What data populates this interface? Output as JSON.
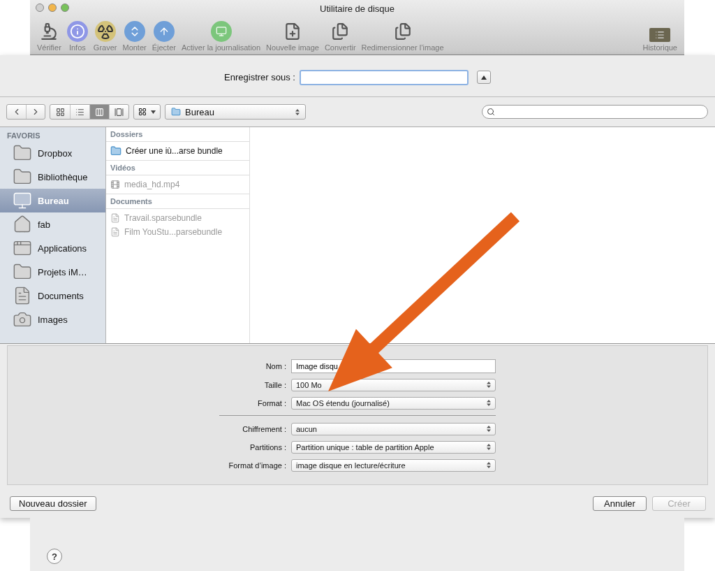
{
  "window": {
    "title": "Utilitaire de disque"
  },
  "toolbar": [
    {
      "label": "Vérifier"
    },
    {
      "label": "Infos"
    },
    {
      "label": "Graver"
    },
    {
      "label": "Monter"
    },
    {
      "label": "Éjecter"
    },
    {
      "label": "Activer la journalisation"
    },
    {
      "label": "Nouvelle image"
    },
    {
      "label": "Convertir"
    },
    {
      "label": "Redimensionner l’image"
    },
    {
      "label": "Historique"
    }
  ],
  "save_as": {
    "label": "Enregistrer sous :"
  },
  "view_modes": [
    {
      "selected": false
    },
    {
      "selected": false
    },
    {
      "selected": true
    },
    {
      "selected": false
    }
  ],
  "location": "Bureau",
  "sidebar": {
    "heading": "FAVORIS",
    "items": [
      {
        "label": "Dropbox",
        "selected": false
      },
      {
        "label": "Bibliothèque",
        "selected": false
      },
      {
        "label": "Bureau",
        "selected": true
      },
      {
        "label": "fab",
        "selected": false
      },
      {
        "label": "Applications",
        "selected": false
      },
      {
        "label": "Projets iM…",
        "selected": false
      },
      {
        "label": "Documents",
        "selected": false
      },
      {
        "label": "Images",
        "selected": false
      }
    ]
  },
  "column": [
    {
      "heading": "Dossiers",
      "items": [
        {
          "name": "Créer une iù...arse bundle",
          "kind": "folder",
          "disabled": false
        }
      ]
    },
    {
      "heading": "Vidéos",
      "items": [
        {
          "name": "media_hd.mp4",
          "kind": "video",
          "disabled": true
        }
      ]
    },
    {
      "heading": "Documents",
      "items": [
        {
          "name": "Travail.sparsebundle",
          "kind": "document",
          "disabled": true
        },
        {
          "name": "Film YouStu...parsebundle",
          "kind": "document",
          "disabled": true
        }
      ]
    }
  ],
  "options": [
    [
      {
        "label": "Nom :",
        "kind": "field",
        "value": "Image disqu"
      },
      {
        "label": "Taille :",
        "kind": "popup",
        "value": "100 Mo"
      },
      {
        "label": "Format :",
        "kind": "popup",
        "value": "Mac OS étendu (journalisé)"
      }
    ],
    [
      {
        "label": "Chiffrement :",
        "kind": "popup",
        "value": "aucun"
      },
      {
        "label": "Partitions :",
        "kind": "popup",
        "value": "Partition unique : table de partition Apple"
      },
      {
        "label": "Format d’image :",
        "kind": "popup",
        "value": "image disque en lecture/écriture"
      }
    ]
  ],
  "buttons": {
    "left": {
      "label": "Nouveau dossier",
      "disabled": false
    },
    "right": [
      {
        "label": "Annuler",
        "disabled": false
      },
      {
        "label": "Créer",
        "disabled": true
      }
    ]
  },
  "help": "?"
}
